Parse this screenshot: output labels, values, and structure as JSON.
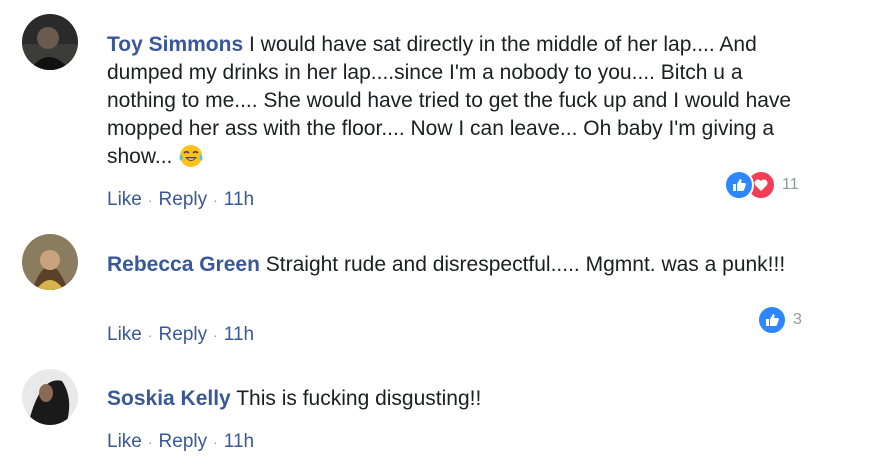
{
  "comments": [
    {
      "author": "Toy Simmons",
      "text": "I would have sat directly in the middle of her lap.... And dumped my drinks in her lap....since I'm a nobody to you.... Bitch u a nothing to me.... She would have tried to get the fuck up and I would have mopped her ass with the floor.... Now I can leave... Oh baby I'm giving a show...",
      "emoji": "tears-of-joy-emoji",
      "like_label": "Like",
      "reply_label": "Reply",
      "time": "11h",
      "reactions": [
        "like",
        "love"
      ],
      "reaction_count": "11"
    },
    {
      "author": "Rebecca Green",
      "text": "Straight rude and disrespectful..... Mgmnt. was a punk!!!",
      "like_label": "Like",
      "reply_label": "Reply",
      "time": "11h",
      "reactions": [
        "like"
      ],
      "reaction_count": "3"
    },
    {
      "author": "Soskia Kelly",
      "text": "This is fucking disgusting!!",
      "like_label": "Like",
      "reply_label": "Reply",
      "time": "11h"
    }
  ],
  "separator": "·",
  "colors": {
    "link": "#385898",
    "like": "#2d88ff",
    "love": "#f33e58",
    "meta": "#90949c"
  }
}
